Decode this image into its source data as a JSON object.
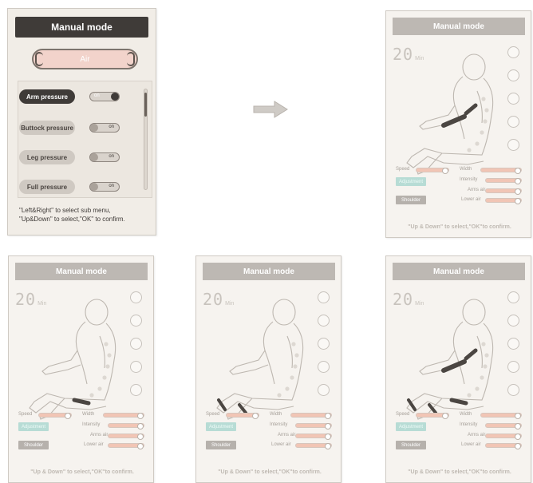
{
  "menu_panel": {
    "title": "Manual mode",
    "tab_label": "Air",
    "items": [
      {
        "label": "Arm pressure",
        "toggle": "on",
        "active": true
      },
      {
        "label": "Buttock pressure",
        "toggle": "on",
        "active": false
      },
      {
        "label": "Leg pressure",
        "toggle": "on",
        "active": false
      },
      {
        "label": "Full pressure",
        "toggle": "on",
        "active": false
      }
    ],
    "hint_line1": "\"Left&Right\" to select sub menu,",
    "hint_line2": "\"Up&Down\" to select,\"OK\" to confirm."
  },
  "screens": {
    "title": "Manual mode",
    "timer": "20",
    "timer_unit": "Min",
    "speed_label": "Speed",
    "width_label": "Width",
    "intensity_label": "Intensity",
    "arms_air_label": "Arms air",
    "lower_air_label": "Lower air",
    "adjustment_label": "Adjustment",
    "shoulder_label": "Shoulder",
    "hint": "\"Up & Down\" to select,\"OK\"to confirm."
  },
  "colors": {
    "dark": "#3f3b38",
    "accent_salmon": "#f1c5b5",
    "accent_teal": "#b7dcd5",
    "panel_bg": "#f4f1ec"
  }
}
